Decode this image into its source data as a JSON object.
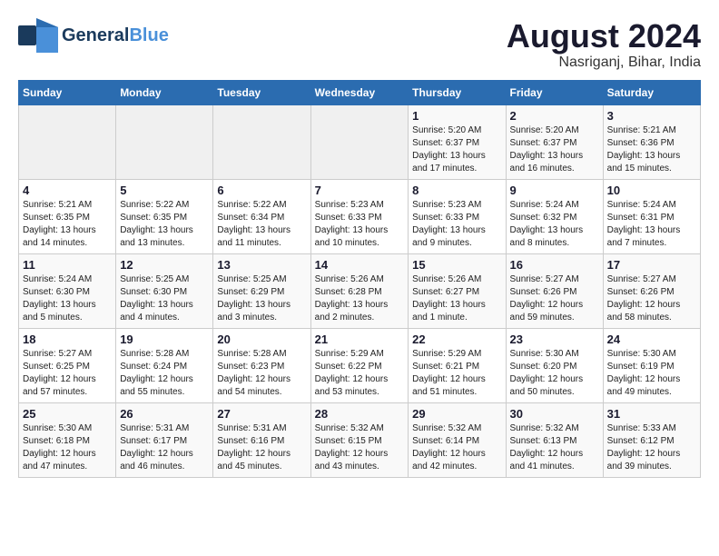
{
  "header": {
    "logo_line1": "General",
    "logo_line2": "Blue",
    "title": "August 2024",
    "subtitle": "Nasriganj, Bihar, India"
  },
  "days_of_week": [
    "Sunday",
    "Monday",
    "Tuesday",
    "Wednesday",
    "Thursday",
    "Friday",
    "Saturday"
  ],
  "weeks": [
    [
      {
        "day": "",
        "info": ""
      },
      {
        "day": "",
        "info": ""
      },
      {
        "day": "",
        "info": ""
      },
      {
        "day": "",
        "info": ""
      },
      {
        "day": "1",
        "info": "Sunrise: 5:20 AM\nSunset: 6:37 PM\nDaylight: 13 hours\nand 17 minutes."
      },
      {
        "day": "2",
        "info": "Sunrise: 5:20 AM\nSunset: 6:37 PM\nDaylight: 13 hours\nand 16 minutes."
      },
      {
        "day": "3",
        "info": "Sunrise: 5:21 AM\nSunset: 6:36 PM\nDaylight: 13 hours\nand 15 minutes."
      }
    ],
    [
      {
        "day": "4",
        "info": "Sunrise: 5:21 AM\nSunset: 6:35 PM\nDaylight: 13 hours\nand 14 minutes."
      },
      {
        "day": "5",
        "info": "Sunrise: 5:22 AM\nSunset: 6:35 PM\nDaylight: 13 hours\nand 13 minutes."
      },
      {
        "day": "6",
        "info": "Sunrise: 5:22 AM\nSunset: 6:34 PM\nDaylight: 13 hours\nand 11 minutes."
      },
      {
        "day": "7",
        "info": "Sunrise: 5:23 AM\nSunset: 6:33 PM\nDaylight: 13 hours\nand 10 minutes."
      },
      {
        "day": "8",
        "info": "Sunrise: 5:23 AM\nSunset: 6:33 PM\nDaylight: 13 hours\nand 9 minutes."
      },
      {
        "day": "9",
        "info": "Sunrise: 5:24 AM\nSunset: 6:32 PM\nDaylight: 13 hours\nand 8 minutes."
      },
      {
        "day": "10",
        "info": "Sunrise: 5:24 AM\nSunset: 6:31 PM\nDaylight: 13 hours\nand 7 minutes."
      }
    ],
    [
      {
        "day": "11",
        "info": "Sunrise: 5:24 AM\nSunset: 6:30 PM\nDaylight: 13 hours\nand 5 minutes."
      },
      {
        "day": "12",
        "info": "Sunrise: 5:25 AM\nSunset: 6:30 PM\nDaylight: 13 hours\nand 4 minutes."
      },
      {
        "day": "13",
        "info": "Sunrise: 5:25 AM\nSunset: 6:29 PM\nDaylight: 13 hours\nand 3 minutes."
      },
      {
        "day": "14",
        "info": "Sunrise: 5:26 AM\nSunset: 6:28 PM\nDaylight: 13 hours\nand 2 minutes."
      },
      {
        "day": "15",
        "info": "Sunrise: 5:26 AM\nSunset: 6:27 PM\nDaylight: 13 hours\nand 1 minute."
      },
      {
        "day": "16",
        "info": "Sunrise: 5:27 AM\nSunset: 6:26 PM\nDaylight: 12 hours\nand 59 minutes."
      },
      {
        "day": "17",
        "info": "Sunrise: 5:27 AM\nSunset: 6:26 PM\nDaylight: 12 hours\nand 58 minutes."
      }
    ],
    [
      {
        "day": "18",
        "info": "Sunrise: 5:27 AM\nSunset: 6:25 PM\nDaylight: 12 hours\nand 57 minutes."
      },
      {
        "day": "19",
        "info": "Sunrise: 5:28 AM\nSunset: 6:24 PM\nDaylight: 12 hours\nand 55 minutes."
      },
      {
        "day": "20",
        "info": "Sunrise: 5:28 AM\nSunset: 6:23 PM\nDaylight: 12 hours\nand 54 minutes."
      },
      {
        "day": "21",
        "info": "Sunrise: 5:29 AM\nSunset: 6:22 PM\nDaylight: 12 hours\nand 53 minutes."
      },
      {
        "day": "22",
        "info": "Sunrise: 5:29 AM\nSunset: 6:21 PM\nDaylight: 12 hours\nand 51 minutes."
      },
      {
        "day": "23",
        "info": "Sunrise: 5:30 AM\nSunset: 6:20 PM\nDaylight: 12 hours\nand 50 minutes."
      },
      {
        "day": "24",
        "info": "Sunrise: 5:30 AM\nSunset: 6:19 PM\nDaylight: 12 hours\nand 49 minutes."
      }
    ],
    [
      {
        "day": "25",
        "info": "Sunrise: 5:30 AM\nSunset: 6:18 PM\nDaylight: 12 hours\nand 47 minutes."
      },
      {
        "day": "26",
        "info": "Sunrise: 5:31 AM\nSunset: 6:17 PM\nDaylight: 12 hours\nand 46 minutes."
      },
      {
        "day": "27",
        "info": "Sunrise: 5:31 AM\nSunset: 6:16 PM\nDaylight: 12 hours\nand 45 minutes."
      },
      {
        "day": "28",
        "info": "Sunrise: 5:32 AM\nSunset: 6:15 PM\nDaylight: 12 hours\nand 43 minutes."
      },
      {
        "day": "29",
        "info": "Sunrise: 5:32 AM\nSunset: 6:14 PM\nDaylight: 12 hours\nand 42 minutes."
      },
      {
        "day": "30",
        "info": "Sunrise: 5:32 AM\nSunset: 6:13 PM\nDaylight: 12 hours\nand 41 minutes."
      },
      {
        "day": "31",
        "info": "Sunrise: 5:33 AM\nSunset: 6:12 PM\nDaylight: 12 hours\nand 39 minutes."
      }
    ]
  ]
}
